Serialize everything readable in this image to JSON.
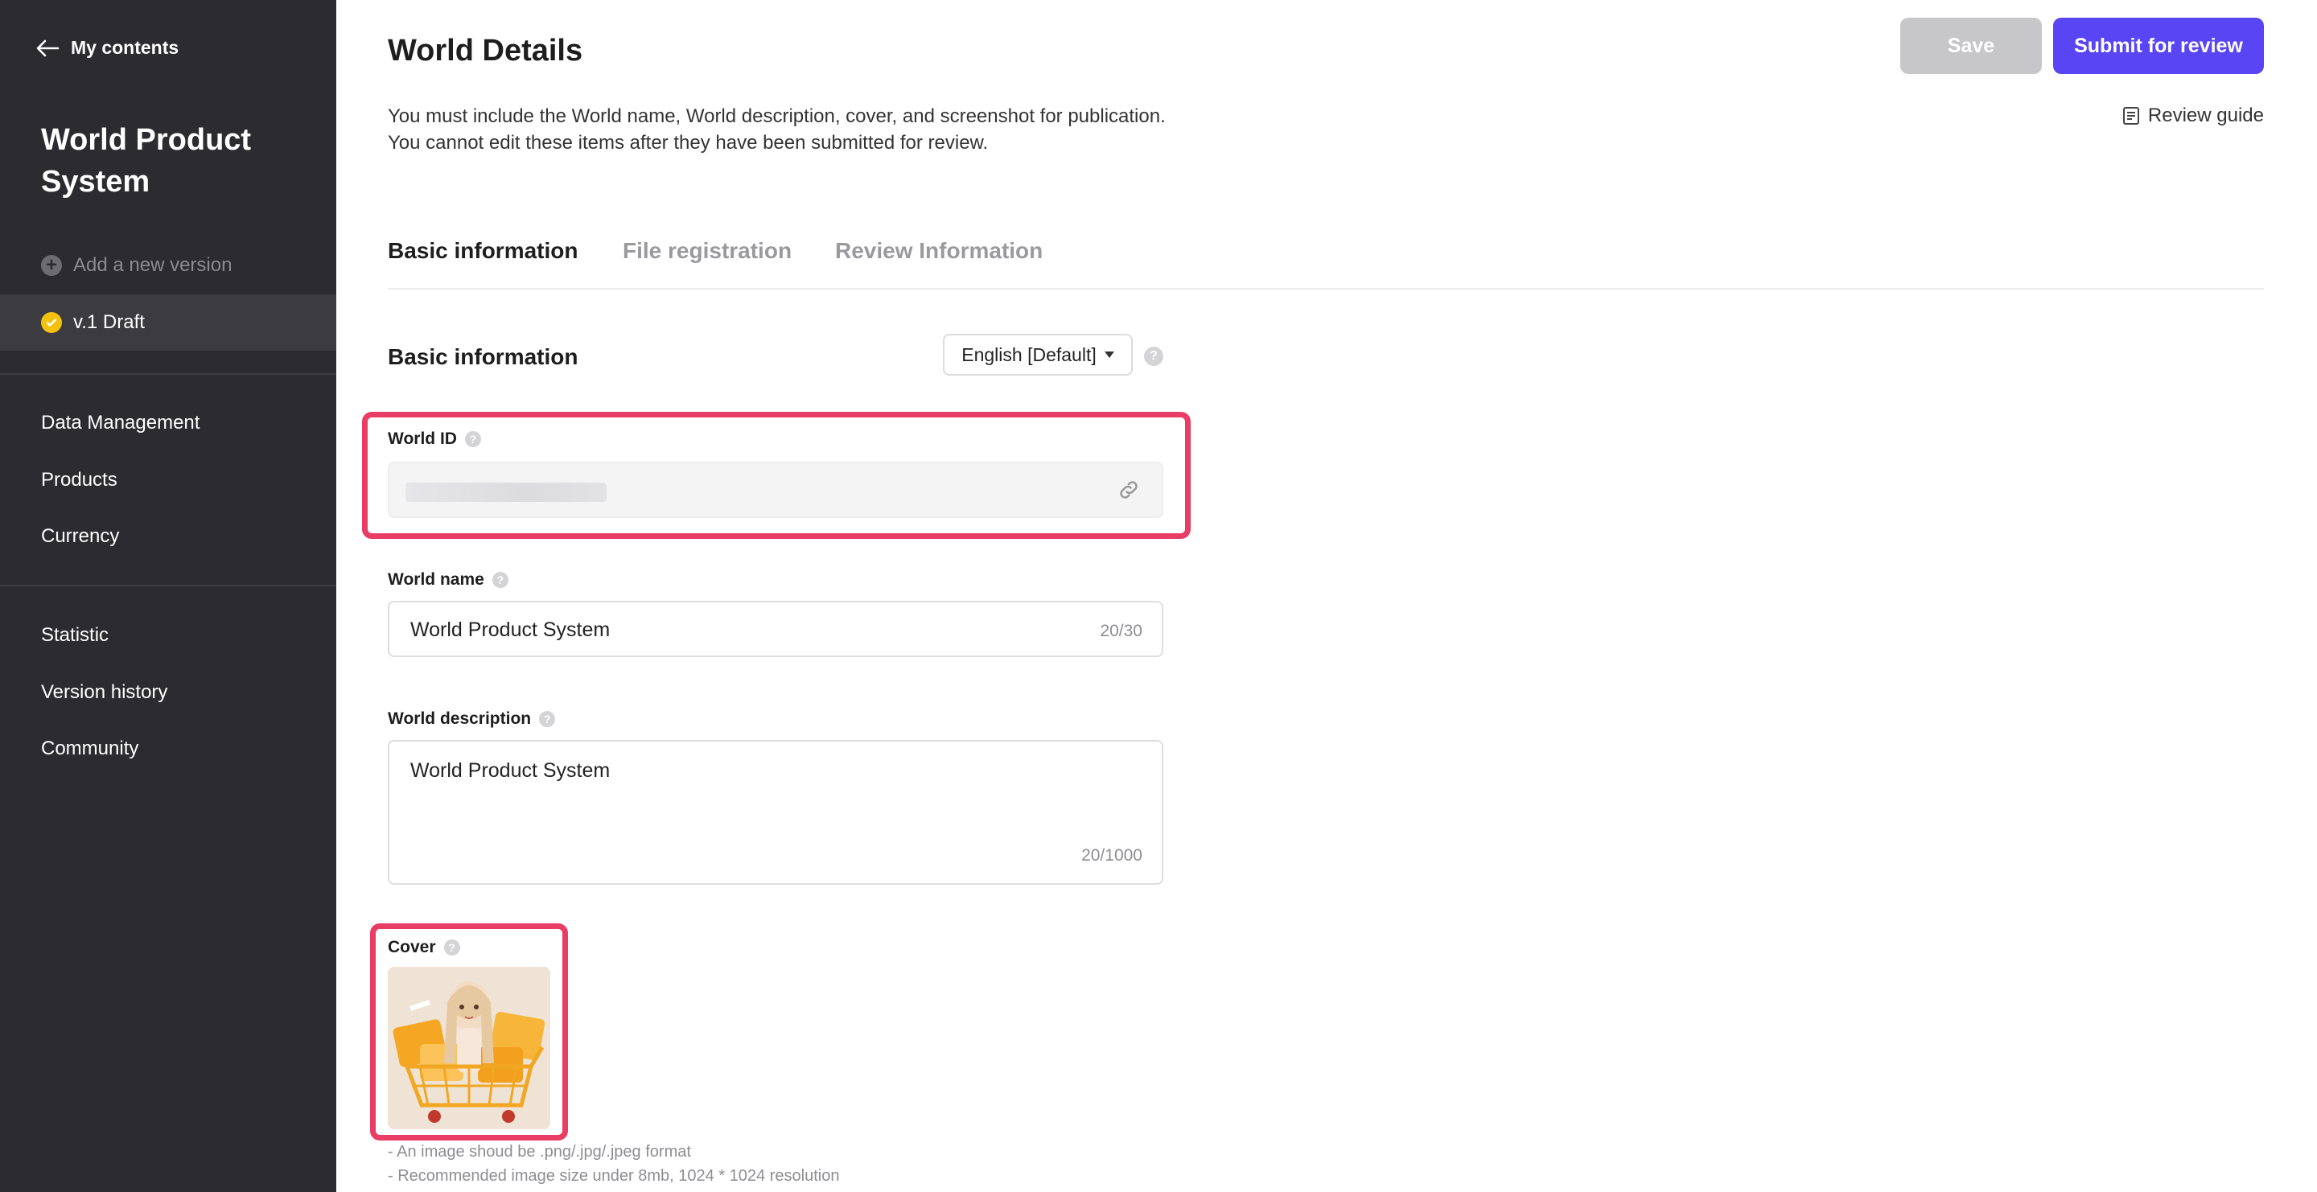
{
  "sidebar": {
    "back_label": "My contents",
    "project_title": "World Product System",
    "add_version_label": "Add a new version",
    "current_version_label": "v.1 Draft",
    "nav_group_1": [
      "Data Management",
      "Products",
      "Currency"
    ],
    "nav_group_2": [
      "Statistic",
      "Version history",
      "Community"
    ]
  },
  "header": {
    "title": "World Details",
    "save_label": "Save",
    "submit_label": "Submit for review",
    "notice_line1": "You must include the World name, World description, cover, and screenshot for publication.",
    "notice_line2": "You cannot edit these items after they have been submitted for review.",
    "review_guide_label": "Review guide"
  },
  "tabs": [
    "Basic information",
    "File registration",
    "Review Information"
  ],
  "active_tab": "Basic information",
  "section": {
    "title": "Basic information",
    "language": "English [Default]"
  },
  "fields": {
    "world_id_label": "World ID",
    "world_name_label": "World name",
    "world_name_value": "World Product System",
    "world_name_counter": "20/30",
    "world_desc_label": "World description",
    "world_desc_value": "World Product System",
    "world_desc_counter": "20/1000",
    "cover_label": "Cover",
    "cover_note_1": "- An image shoud be .png/.jpg/.jpeg format",
    "cover_note_2": "- Recommended image size under 8mb, 1024 * 1024 resolution"
  },
  "colors": {
    "sidebar_bg": "#2b2b30",
    "accent": "#5a45f5",
    "highlight": "#e83e66",
    "draft_badge": "#f4c20d"
  },
  "icons": {
    "back": "arrow-left-icon",
    "add": "plus-circle-icon",
    "draft": "check-circle-icon",
    "guide": "document-icon",
    "help": "question-icon",
    "link": "link-icon",
    "caret": "caret-down-icon"
  }
}
